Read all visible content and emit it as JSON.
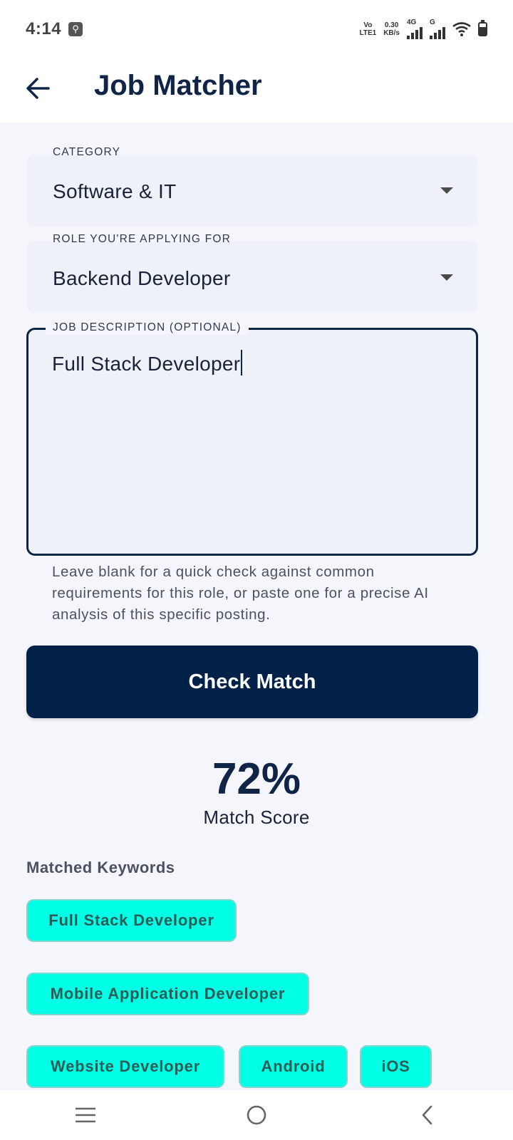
{
  "status_bar": {
    "time": "4:14",
    "volte": "Vo",
    "lte": "LTE1",
    "net_speed_value": "0.30",
    "net_speed_unit": "KB/s",
    "network_4g": "4G",
    "network_g": "G"
  },
  "header": {
    "title": "Job Matcher"
  },
  "form": {
    "category": {
      "label": "CATEGORY",
      "value": "Software & IT"
    },
    "role": {
      "label": "ROLE YOU'RE APPLYING FOR",
      "value": "Backend Developer"
    },
    "job_description": {
      "label": "JOB DESCRIPTION (OPTIONAL)",
      "value": "Full Stack Developer"
    },
    "helper_text": "Leave blank for a quick check against common requirements for this role, or paste one for a precise AI analysis of this specific posting.",
    "submit_label": "Check Match"
  },
  "result": {
    "score": "72%",
    "score_label": "Match Score",
    "matched_heading": "Matched Keywords",
    "keywords": [
      "Full Stack Developer",
      "Mobile Application Developer",
      "Website Developer",
      "Android",
      "iOS"
    ]
  },
  "colors": {
    "primary": "#022148",
    "chip": "#00ffe4",
    "background": "#f4f6fc"
  },
  "icons": {
    "back": "arrow-left-icon",
    "dropdown": "caret-down-icon",
    "nav_recents": "menu-icon",
    "nav_home": "circle-icon",
    "nav_back": "chevron-left-icon"
  }
}
